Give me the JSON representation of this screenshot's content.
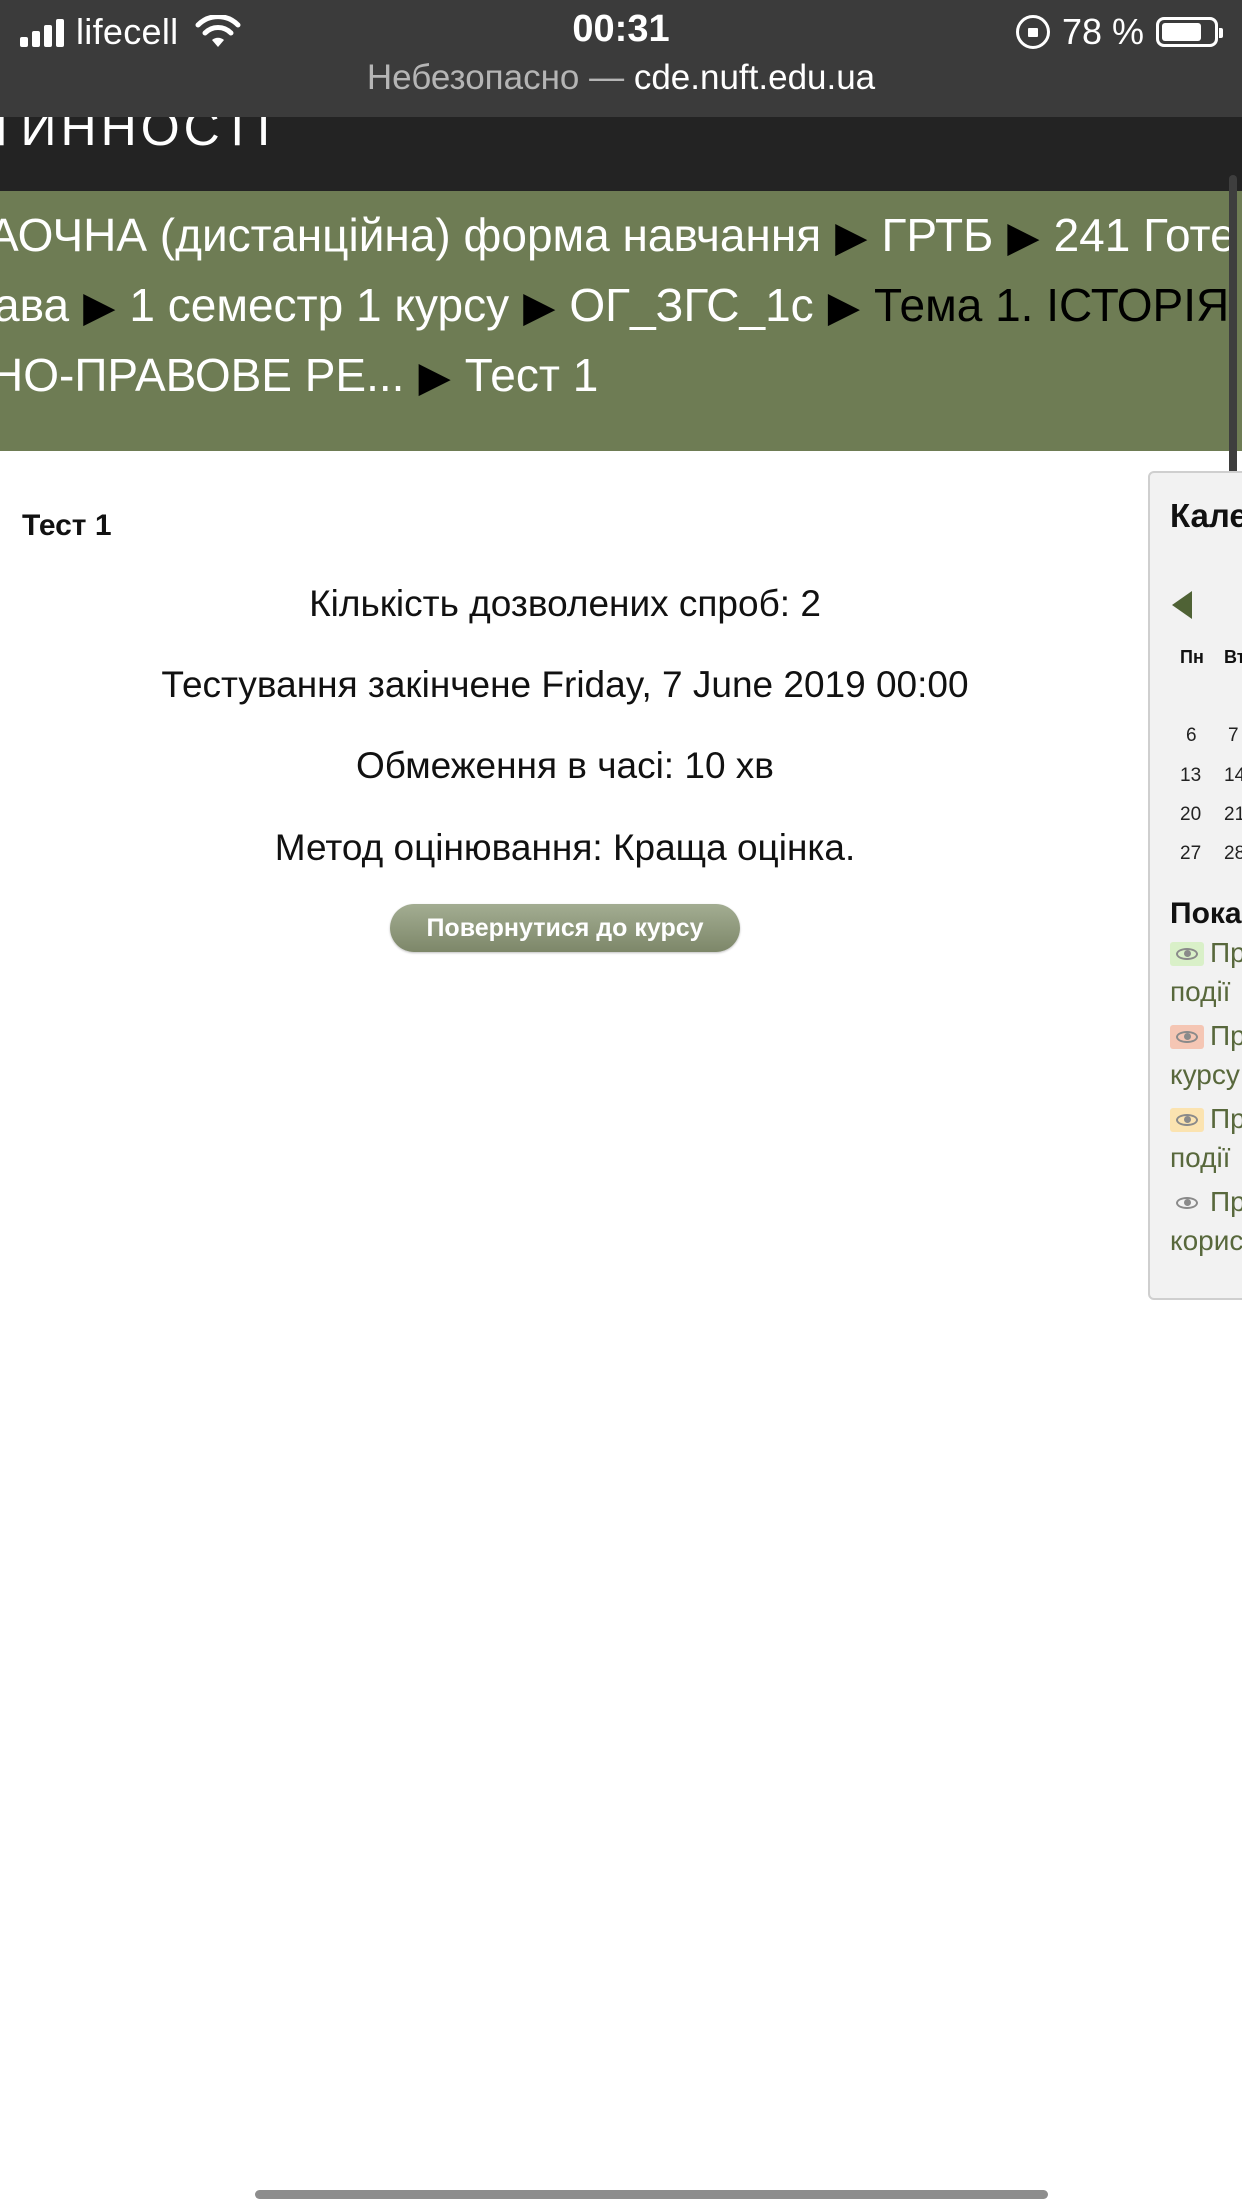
{
  "status_bar": {
    "carrier": "lifecell",
    "time": "00:31",
    "battery": "78 %",
    "battery_level": 0.78
  },
  "url_bar": {
    "security": "Небезопасно —",
    "domain": "cde.nuft.edu.ua"
  },
  "header": {
    "title": "ТИННОСТІ"
  },
  "breadcrumb": {
    "lines": [
      [
        "АОЧНА (дистанційна) форма навчання",
        "ГРТБ",
        "241 Готе"
      ],
      [
        "ава",
        "1 семестр 1 курсу",
        "ОГ_ЗГС_1с",
        "Тема 1. ІСТОРІЯ"
      ],
      [
        "НО-ПРАВОВЕ РЕ...",
        "Тест 1"
      ]
    ]
  },
  "quiz": {
    "name": "Тест 1",
    "attempts": "Кількість дозволених спроб: 2",
    "closed": "Тестування закінчене Friday, 7 June 2019 00:00",
    "time_limit": "Обмеження в часі: 10 хв",
    "grading": "Метод оцінювання: Краща оцінка.",
    "back_button": "Повернутися до курсу"
  },
  "calendar": {
    "title": "Кале",
    "weekdays": [
      "Пн",
      "Вт"
    ],
    "weeks": [
      [
        "6",
        "7"
      ],
      [
        "13",
        "14"
      ],
      [
        "20",
        "21"
      ],
      [
        "27",
        "28"
      ]
    ],
    "show_title": "Пока",
    "legend": [
      {
        "label": "Пр",
        "line2": "події",
        "color": "#d9f0c8"
      },
      {
        "label": "Пр",
        "line2": "курсу",
        "color": "#f5c6b4"
      },
      {
        "label": "Пр",
        "line2": "події",
        "color": "#fbe3b0"
      },
      {
        "label": "Пр",
        "line2": "корист",
        "color": "#f2f2f2"
      }
    ]
  }
}
